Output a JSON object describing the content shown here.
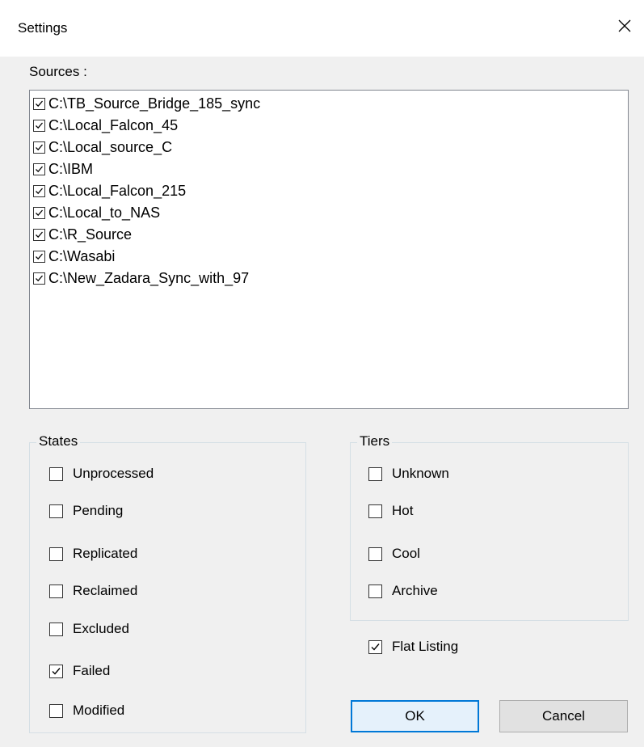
{
  "window": {
    "title": "Settings",
    "close_icon": "close-icon"
  },
  "sources": {
    "label": "Sources :",
    "items": [
      {
        "path": "C:\\TB_Source_Bridge_185_sync",
        "checked": true
      },
      {
        "path": "C:\\Local_Falcon_45",
        "checked": true
      },
      {
        "path": "C:\\Local_source_C",
        "checked": true
      },
      {
        "path": "C:\\IBM",
        "checked": true
      },
      {
        "path": "C:\\Local_Falcon_215",
        "checked": true
      },
      {
        "path": "C:\\Local_to_NAS",
        "checked": true
      },
      {
        "path": "C:\\R_Source",
        "checked": true
      },
      {
        "path": "C:\\Wasabi",
        "checked": true
      },
      {
        "path": "C:\\New_Zadara_Sync_with_97",
        "checked": true
      }
    ]
  },
  "states": {
    "title": "States",
    "items": [
      {
        "label": "Unprocessed",
        "checked": false
      },
      {
        "label": "Pending",
        "checked": false
      },
      {
        "label": "Replicated",
        "checked": false
      },
      {
        "label": "Reclaimed",
        "checked": false
      },
      {
        "label": "Excluded",
        "checked": false
      },
      {
        "label": "Failed",
        "checked": true
      },
      {
        "label": "Modified",
        "checked": false
      }
    ]
  },
  "tiers": {
    "title": "Tiers",
    "items": [
      {
        "label": "Unknown",
        "checked": false
      },
      {
        "label": "Hot",
        "checked": false
      },
      {
        "label": "Cool",
        "checked": false
      },
      {
        "label": "Archive",
        "checked": false
      }
    ]
  },
  "flat_listing": {
    "label": "Flat Listing",
    "checked": true
  },
  "buttons": {
    "ok": "OK",
    "cancel": "Cancel"
  }
}
